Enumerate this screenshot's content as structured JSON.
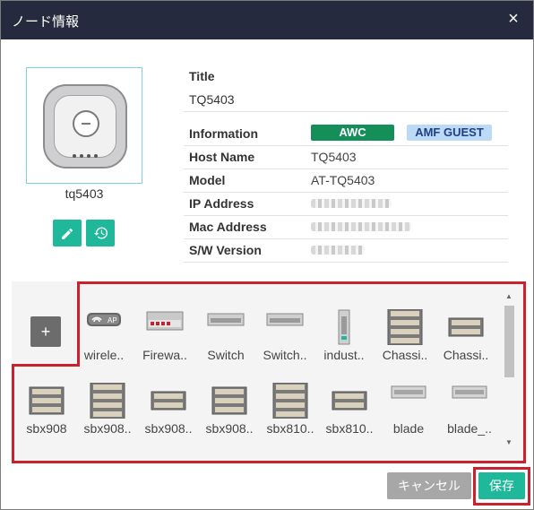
{
  "dialog": {
    "title": "ノード情報",
    "close_label": "×"
  },
  "node": {
    "label": "tq5403"
  },
  "fields": {
    "title_key": "Title",
    "title_value": "TQ5403",
    "information_key": "Information",
    "badges": [
      {
        "label": "AWC",
        "bg": "#148f5a",
        "color": "#ffffff"
      },
      {
        "label": "AMF GUEST",
        "bg": "#bcdaf6",
        "color": "#1d3f87"
      }
    ],
    "rows": [
      {
        "key": "Host Name",
        "value": "TQ5403"
      },
      {
        "key": "Model",
        "value": "AT-TQ5403"
      },
      {
        "key": "IP Address",
        "value": ""
      },
      {
        "key": "Mac Address",
        "value": ""
      },
      {
        "key": "S/W Version",
        "value": ""
      }
    ]
  },
  "icon_picker": {
    "add_label": "+",
    "items": [
      {
        "label": "wirele..",
        "icon": "wireless-ap-icon"
      },
      {
        "label": "Firewa..",
        "icon": "firewall-icon"
      },
      {
        "label": "Switch",
        "icon": "switch-icon"
      },
      {
        "label": "Switch..",
        "icon": "switch-icon"
      },
      {
        "label": "indust..",
        "icon": "industrial-switch-icon"
      },
      {
        "label": "Chassi..",
        "icon": "chassis-icon"
      },
      {
        "label": "Chassi..",
        "icon": "chassis-icon"
      },
      {
        "label": "sbx908",
        "icon": "chassis-icon"
      },
      {
        "label": "sbx908..",
        "icon": "chassis-icon"
      },
      {
        "label": "sbx908..",
        "icon": "chassis-icon"
      },
      {
        "label": "sbx908..",
        "icon": "chassis-icon"
      },
      {
        "label": "sbx810..",
        "icon": "chassis-icon"
      },
      {
        "label": "sbx810..",
        "icon": "chassis-icon"
      },
      {
        "label": "blade",
        "icon": "blade-icon"
      },
      {
        "label": "blade_..",
        "icon": "blade-icon"
      }
    ]
  },
  "buttons": {
    "cancel": "キャンセル",
    "save": "保存"
  },
  "colors": {
    "titlebar": "#262a3e",
    "accent": "#1fb89a",
    "highlight": "#c9222e",
    "cancel": "#a7a7a7"
  }
}
